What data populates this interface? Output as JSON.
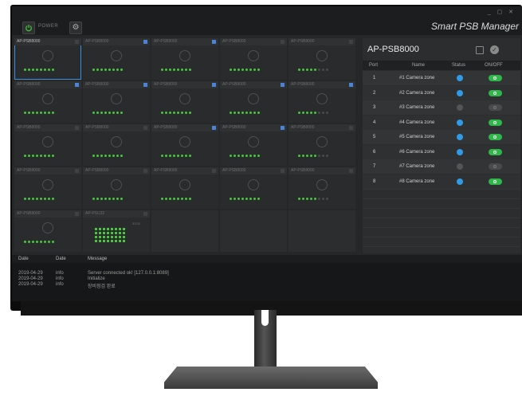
{
  "app": {
    "title": "Smart PSB Manager",
    "power_label": "POWER",
    "window_controls": "_ ▢ ✕"
  },
  "devices": [
    {
      "name": "AP-PSB8000",
      "checked": false,
      "selected": true,
      "dots": [
        1,
        1,
        1,
        1,
        1,
        1,
        1,
        1
      ]
    },
    {
      "name": "AP-PSB8000",
      "checked": true,
      "dots": [
        1,
        1,
        1,
        1,
        1,
        1,
        1,
        1
      ]
    },
    {
      "name": "AP-PSB8000",
      "checked": true,
      "dots": [
        1,
        1,
        1,
        1,
        1,
        1,
        1,
        1
      ]
    },
    {
      "name": "AP-PSB8000",
      "checked": false,
      "dots": [
        1,
        1,
        1,
        1,
        1,
        1,
        1,
        1
      ]
    },
    {
      "name": "AP-PSB8000",
      "checked": false,
      "dots": [
        1,
        1,
        1,
        1,
        1,
        0,
        0,
        0
      ]
    },
    {
      "name": "AP-PSB8000",
      "checked": true,
      "dots": [
        1,
        1,
        1,
        1,
        1,
        1,
        1,
        1
      ]
    },
    {
      "name": "AP-PSB8000",
      "checked": true,
      "dots": [
        1,
        1,
        1,
        1,
        1,
        1,
        1,
        1
      ]
    },
    {
      "name": "AP-PSB8000",
      "checked": true,
      "dots": [
        1,
        1,
        1,
        1,
        1,
        1,
        1,
        1
      ]
    },
    {
      "name": "AP-PSB8000",
      "checked": true,
      "dots": [
        1,
        1,
        1,
        1,
        1,
        1,
        1,
        1
      ]
    },
    {
      "name": "AP-PSB8000",
      "checked": true,
      "dots": [
        1,
        1,
        1,
        1,
        1,
        0,
        0,
        0
      ]
    },
    {
      "name": "AP-PSB8000",
      "checked": false,
      "dots": [
        1,
        1,
        1,
        1,
        1,
        1,
        1,
        1
      ]
    },
    {
      "name": "AP-PSB8000",
      "checked": false,
      "dots": [
        1,
        1,
        1,
        1,
        1,
        1,
        1,
        1
      ]
    },
    {
      "name": "AP-PSB8000",
      "checked": true,
      "dots": [
        1,
        1,
        1,
        1,
        1,
        1,
        1,
        1
      ]
    },
    {
      "name": "AP-PSB8000",
      "checked": true,
      "dots": [
        1,
        1,
        1,
        1,
        1,
        1,
        1,
        1
      ]
    },
    {
      "name": "AP-PSB8000",
      "checked": false,
      "dots": [
        1,
        1,
        1,
        1,
        1,
        0,
        0,
        0
      ]
    },
    {
      "name": "AP-PSB8000",
      "checked": false,
      "dots": [
        1,
        1,
        1,
        1,
        1,
        1,
        1,
        1
      ]
    },
    {
      "name": "AP-PSB8000",
      "checked": false,
      "dots": [
        1,
        1,
        1,
        1,
        1,
        1,
        1,
        1
      ]
    },
    {
      "name": "AP-PSB8000",
      "checked": false,
      "dots": [
        1,
        1,
        1,
        1,
        1,
        1,
        1,
        1
      ]
    },
    {
      "name": "AP-PSB8000",
      "checked": false,
      "dots": [
        1,
        1,
        1,
        1,
        1,
        1,
        1,
        1
      ]
    },
    {
      "name": "AP-PSB8000",
      "checked": false,
      "dots": [
        1,
        1,
        1,
        1,
        1,
        0,
        0,
        0
      ]
    },
    {
      "name": "AP-PSB8000",
      "checked": false,
      "dots": [
        1,
        1,
        1,
        1,
        1,
        1,
        1,
        1
      ]
    },
    {
      "name": "AP-PSU32",
      "checked": false,
      "big": true,
      "count": "32/32"
    }
  ],
  "panel": {
    "title": "AP-PSB8000",
    "columns": {
      "port": "Port",
      "name": "Name",
      "status": "Status",
      "onoff": "ON/OFF"
    },
    "rows": [
      {
        "port": "1",
        "name": "#1 Camera zone",
        "status": "on",
        "power": "on"
      },
      {
        "port": "2",
        "name": "#2 Camera zone",
        "status": "on",
        "power": "on"
      },
      {
        "port": "3",
        "name": "#3 Camera zone",
        "status": "off",
        "power": "off"
      },
      {
        "port": "4",
        "name": "#4 Camera zone",
        "status": "on",
        "power": "on"
      },
      {
        "port": "5",
        "name": "#5 Camera zone",
        "status": "on",
        "power": "on"
      },
      {
        "port": "6",
        "name": "#6 Camera zone",
        "status": "on",
        "power": "on"
      },
      {
        "port": "7",
        "name": "#7 Camera zone",
        "status": "off",
        "power": "off"
      },
      {
        "port": "8",
        "name": "#8 Camera zone",
        "status": "on",
        "power": "on"
      }
    ]
  },
  "log": {
    "columns": {
      "date": "Date",
      "level": "Date",
      "message": "Message"
    },
    "entries": [
      {
        "date": "2019-04-29",
        "level": "info",
        "message": "Server connected ok! [127.0.0.1:8089]"
      },
      {
        "date": "2019-04-29",
        "level": "info",
        "message": "Initialize"
      },
      {
        "date": "2019-04-29",
        "level": "info",
        "message": "장비점검 완료"
      }
    ]
  },
  "colors": {
    "accent": "#4a84d8",
    "green": "#48c63c",
    "status_on": "#2f9be8",
    "status_off": "#555555",
    "toggle_on": "#2fb84a",
    "toggle_off": "#4a4a4a"
  }
}
